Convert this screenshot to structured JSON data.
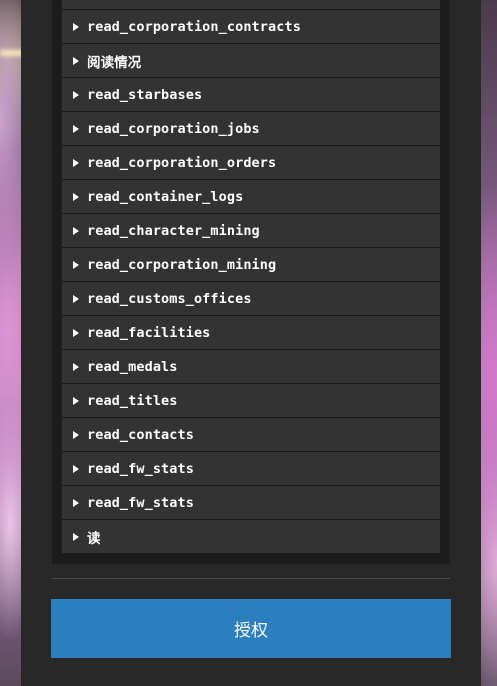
{
  "scopes": [
    "read_corporation_contracts",
    "阅读情况",
    "read_starbases",
    "read_corporation_jobs",
    "read_corporation_orders",
    "read_container_logs",
    "read_character_mining",
    "read_corporation_mining",
    "read_customs_offices",
    "read_facilities",
    "read_medals",
    "read_titles",
    "read_contacts",
    "read_fw_stats",
    "read_fw_stats",
    "读"
  ],
  "authorize_button": "授权",
  "colors": {
    "panel": "#282829",
    "list_item": "#333334",
    "button": "#2c7fbf"
  }
}
